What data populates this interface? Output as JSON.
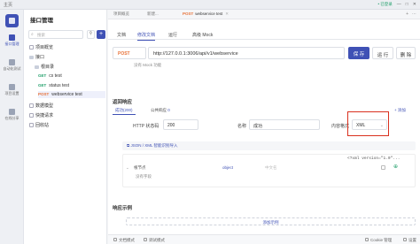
{
  "titlebar": {
    "home": "主页",
    "status": "• 已登录",
    "window_controls": [
      "—",
      "□",
      "✕"
    ]
  },
  "rail": {
    "items": [
      {
        "label": "接口管理",
        "icon": "api-icon",
        "active": true
      },
      {
        "label": "自动化测试",
        "icon": "test-icon",
        "active": false
      },
      {
        "label": "项目设置",
        "icon": "settings-icon",
        "active": false
      },
      {
        "label": "在线分享",
        "icon": "share-icon",
        "active": false
      }
    ]
  },
  "tree": {
    "title": "接口管理",
    "search_placeholder": "搜索",
    "filter_icon": "filter-icon",
    "add_label": "+",
    "nodes": [
      {
        "label": "项目概览"
      },
      {
        "label": "接口"
      },
      {
        "label": "根目录"
      },
      {
        "method": "GET",
        "label": "cs test"
      },
      {
        "method": "GET",
        "label": "status test"
      },
      {
        "method": "POST",
        "label": "webservice test"
      },
      {
        "label": "数据模型"
      },
      {
        "label": "快捷请求"
      },
      {
        "label": "回收站"
      }
    ]
  },
  "tabs": [
    {
      "label": "项目概览"
    },
    {
      "label": "新建..."
    },
    {
      "method": "POST",
      "label": "webservice test",
      "active": true
    }
  ],
  "subtabs": [
    {
      "label": "文档",
      "active": false
    },
    {
      "label": "修改文档",
      "active": true
    },
    {
      "label": "运行",
      "active": false
    },
    {
      "label": "高级 Mock",
      "active": false
    }
  ],
  "request": {
    "method": "POST",
    "url": "http://127.0.0.1:3006/api/v1/webservice",
    "save_label": "保 存",
    "run_label": "运 行",
    "delete_label": "删 除",
    "hint": "没有 Mock 功能"
  },
  "response": {
    "section_title": "返回响应",
    "tabs": [
      {
        "label": "成功(200)",
        "active": true
      },
      {
        "label": "公共响应",
        "count": "0",
        "active": false
      }
    ],
    "add_label": "+ 添加",
    "status_code_label": "HTTP 状态码",
    "status_code_value": "200",
    "name_label": "名称",
    "name_value": "成功",
    "content_type_label": "内容格式",
    "content_type_value": "XML",
    "json_bar": "JSON / XML 智能识别导入",
    "schema": {
      "xml_header": "<?xml version=\"1.0\"...",
      "root_label": "根节点",
      "root_type": "object",
      "root_desc": "中文名",
      "hint": "没有字段"
    }
  },
  "examples": {
    "section_title": "响应示例",
    "add_label": "添加示例"
  },
  "statusbar": {
    "left": [
      "文档模式",
      "调试模式"
    ],
    "right": [
      "Cookie 管理",
      "设置"
    ]
  }
}
